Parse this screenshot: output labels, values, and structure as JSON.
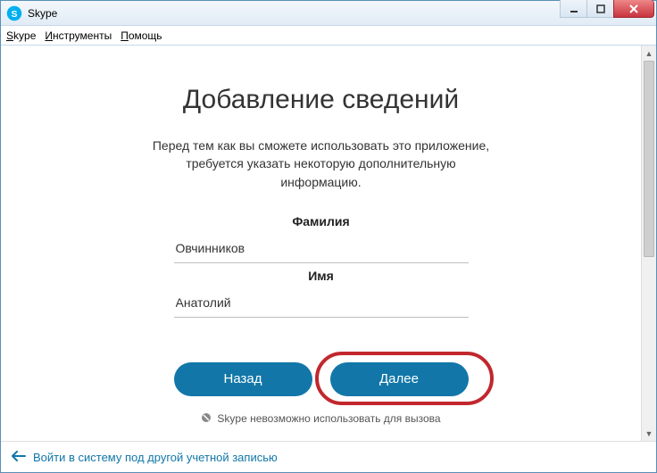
{
  "window": {
    "title": "Skype"
  },
  "menubar": {
    "skype": "Skype",
    "tools": "Инструменты",
    "help": "Помощь"
  },
  "page": {
    "title": "Добавление сведений",
    "description": "Перед тем как вы сможете использовать это приложение, требуется указать некоторую дополнительную информацию.",
    "lastname_label": "Фамилия",
    "lastname_value": "Овчинников",
    "firstname_label": "Имя",
    "firstname_value": "Анатолий",
    "back_label": "Назад",
    "next_label": "Далее",
    "status_text": "Skype невозможно использовать для вызова"
  },
  "footer": {
    "signin_other": "Войти в систему под другой учетной записью"
  }
}
